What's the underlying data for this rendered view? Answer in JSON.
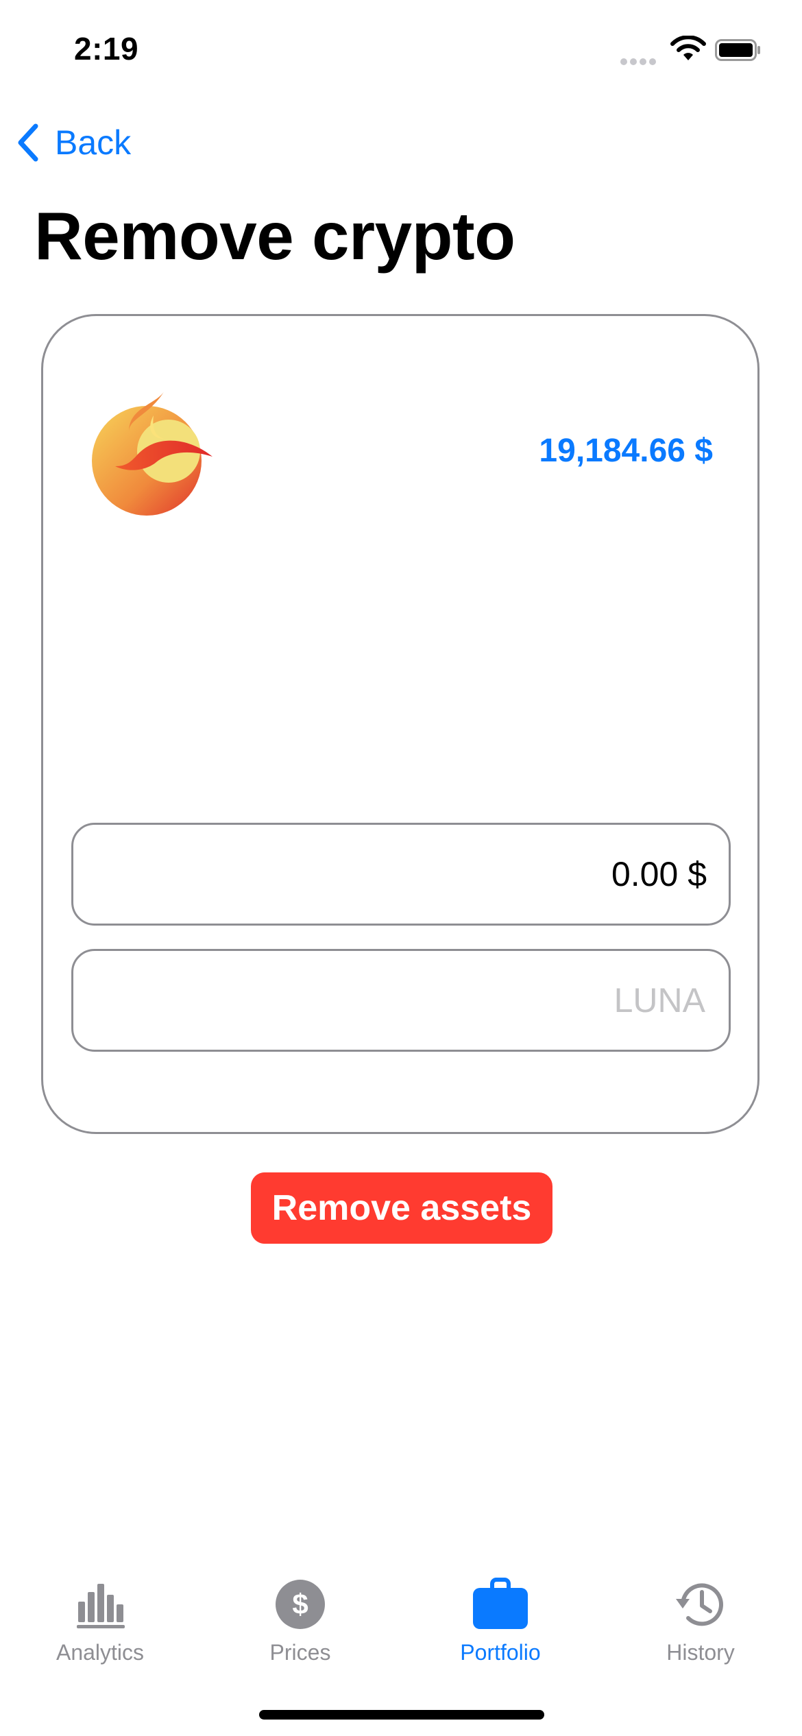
{
  "status_bar": {
    "time": "2:19"
  },
  "nav": {
    "back_label": "Back"
  },
  "page": {
    "title": "Remove crypto"
  },
  "coin": {
    "icon": "luna-logo-icon",
    "value": "19,184.66 $"
  },
  "form": {
    "usd_value": "0.00 $",
    "luna_value": "",
    "luna_placeholder": "LUNA"
  },
  "actions": {
    "remove_label": "Remove assets"
  },
  "tab_bar": {
    "items": [
      {
        "label": "Analytics",
        "icon": "chart-bar-icon",
        "active": false
      },
      {
        "label": "Prices",
        "icon": "dollar-circle-icon",
        "active": false
      },
      {
        "label": "Portfolio",
        "icon": "briefcase-icon",
        "active": true
      },
      {
        "label": "History",
        "icon": "history-clock-icon",
        "active": false
      }
    ]
  },
  "colors": {
    "accent": "#0a7aff",
    "destructive": "#ff3b30",
    "inactive": "#8e8e93",
    "border": "#8e8e93"
  }
}
